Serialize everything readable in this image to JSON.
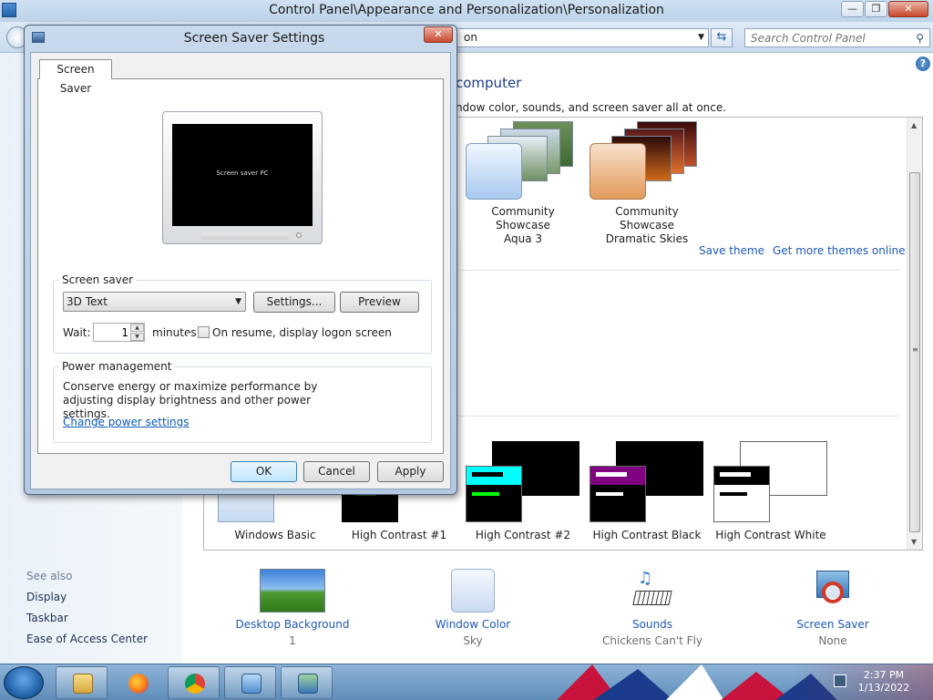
{
  "control_panel": {
    "title": "Control Panel\\Appearance and Personalization\\Personalization",
    "window_buttons": {
      "minimize": "—",
      "maximize": "❐",
      "close": "✕"
    },
    "address_visible": "on",
    "search_placeholder": "Search Control Panel",
    "help": "?",
    "heading": "computer",
    "subheading": "ndow color, sounds, and screen saver all at once.",
    "themes_top": [
      {
        "name": "Community Showcase",
        "line2": "Aqua 3"
      },
      {
        "name": "Community Showcase",
        "line2": "Dramatic Skies"
      }
    ],
    "save_theme": "Save theme",
    "get_more_themes": "Get more themes online",
    "themes_bottom": [
      "Windows Basic",
      "High Contrast #1",
      "High Contrast #2",
      "High Contrast Black",
      "High Contrast White"
    ],
    "see_also": {
      "title": "See also",
      "links": [
        "Display",
        "Taskbar",
        "Ease of Access Center"
      ]
    },
    "bottom_items": [
      {
        "label": "Desktop Background",
        "value": "1",
        "icon": "desktop-background-icon"
      },
      {
        "label": "Window Color",
        "value": "Sky",
        "icon": "window-color-icon"
      },
      {
        "label": "Sounds",
        "value": "Chickens Can't Fly",
        "icon": "sounds-icon"
      },
      {
        "label": "Screen Saver",
        "value": "None",
        "icon": "screen-saver-icon"
      }
    ]
  },
  "dialog": {
    "title": "Screen Saver Settings",
    "close": "✕",
    "tab": "Screen Saver",
    "preview_text": "Screen saver PC",
    "screen_saver_group": "Screen saver",
    "selected_screensaver": "3D Text",
    "settings_button": "Settings...",
    "preview_button": "Preview",
    "wait_label": "Wait:",
    "wait_value": "1",
    "minutes_label": "minutes",
    "resume_label": "On resume, display logon screen",
    "resume_checked": false,
    "power_group": "Power management",
    "power_text": "Conserve energy or maximize performance by adjusting display brightness and other power settings.",
    "power_link": "Change power settings",
    "ok": "OK",
    "cancel": "Cancel",
    "apply": "Apply"
  },
  "taskbar": {
    "time": "2:37 PM",
    "date": "1/13/2022",
    "apps": [
      "file-explorer-icon",
      "firefox-icon",
      "chrome-icon",
      "control-panel-icon",
      "screen-saver-app-icon"
    ]
  },
  "colors": {
    "link": "#1e59b8",
    "accent": "#1e3f8a",
    "hc2_cyan": "#00ffff",
    "hc2_green": "#00ff00",
    "hc_black_purple": "#800080"
  }
}
